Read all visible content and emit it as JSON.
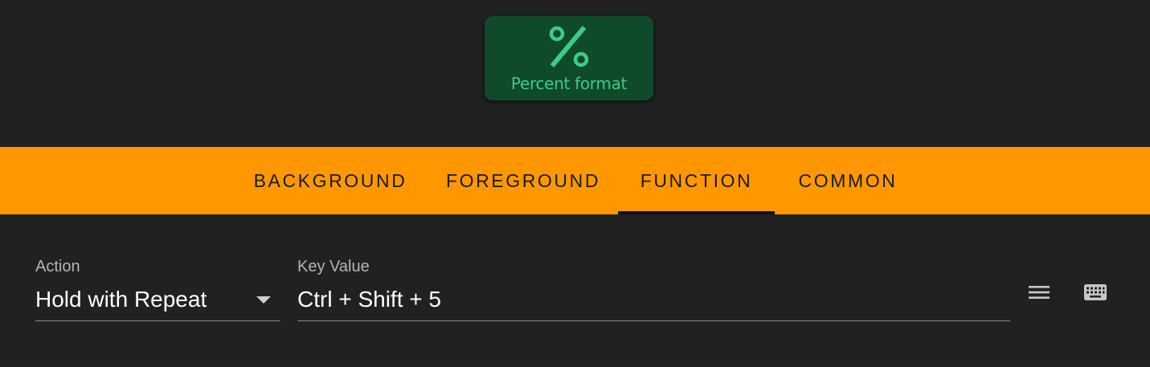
{
  "preview": {
    "label": "Percent format",
    "icon": "percent-icon",
    "background": "#0f4a2a",
    "accent": "#3dcc84"
  },
  "tabs": [
    {
      "label": "BACKGROUND",
      "selected": false
    },
    {
      "label": "FOREGROUND",
      "selected": false
    },
    {
      "label": "FUNCTION",
      "selected": true
    },
    {
      "label": "COMMON",
      "selected": false
    }
  ],
  "tabbar_color": "#ff9800",
  "action": {
    "label": "Action",
    "value": "Hold with Repeat"
  },
  "key_value": {
    "label": "Key Value",
    "value": "Ctrl + Shift + 5"
  },
  "buttons": {
    "menu_icon": "menu-icon",
    "keyboard_icon": "keyboard-icon"
  }
}
